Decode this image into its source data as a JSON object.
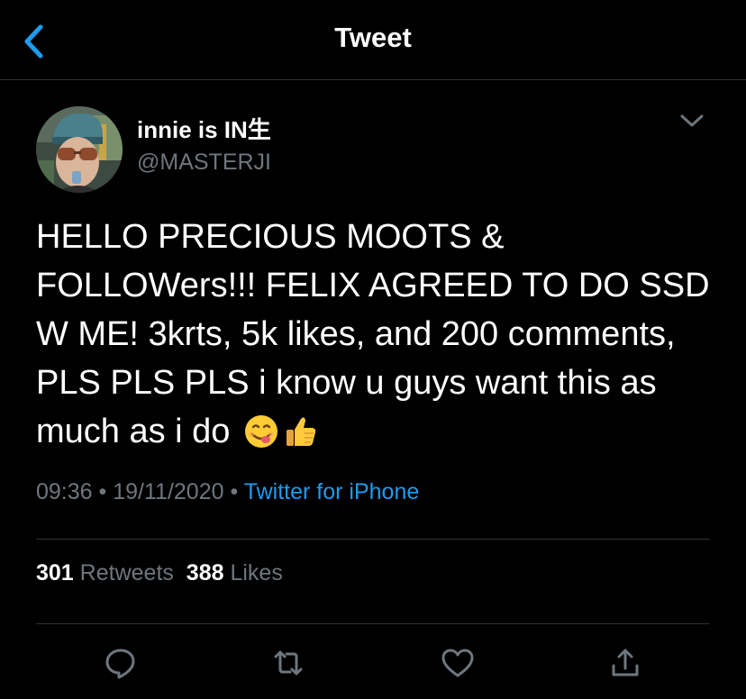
{
  "header": {
    "title": "Tweet"
  },
  "author": {
    "display_name": "innie is IN生",
    "handle": "@MASTERJI"
  },
  "tweet": {
    "text": "HELLO PRECIOUS MOOTS & FOLLOWers!!! FELIX AGREED TO DO SSD W ME! 3krts, 5k likes, and 200 comments, PLS PLS PLS i know u guys want this as much as i do",
    "emojis": [
      "face-savoring-food-emoji",
      "thumbs-up-emoji"
    ],
    "time": "09:36",
    "separator": "•",
    "date": "19/11/2020",
    "source": "Twitter for iPhone"
  },
  "stats": {
    "retweets_count": "301",
    "retweets_label": "Retweets",
    "likes_count": "388",
    "likes_label": "Likes"
  },
  "actions": [
    "reply-icon",
    "retweet-icon",
    "like-icon",
    "share-icon"
  ],
  "colors": {
    "background": "#000000",
    "accent": "#1d9bf0",
    "secondary_text": "#6e767d",
    "divider": "#2f3336"
  }
}
